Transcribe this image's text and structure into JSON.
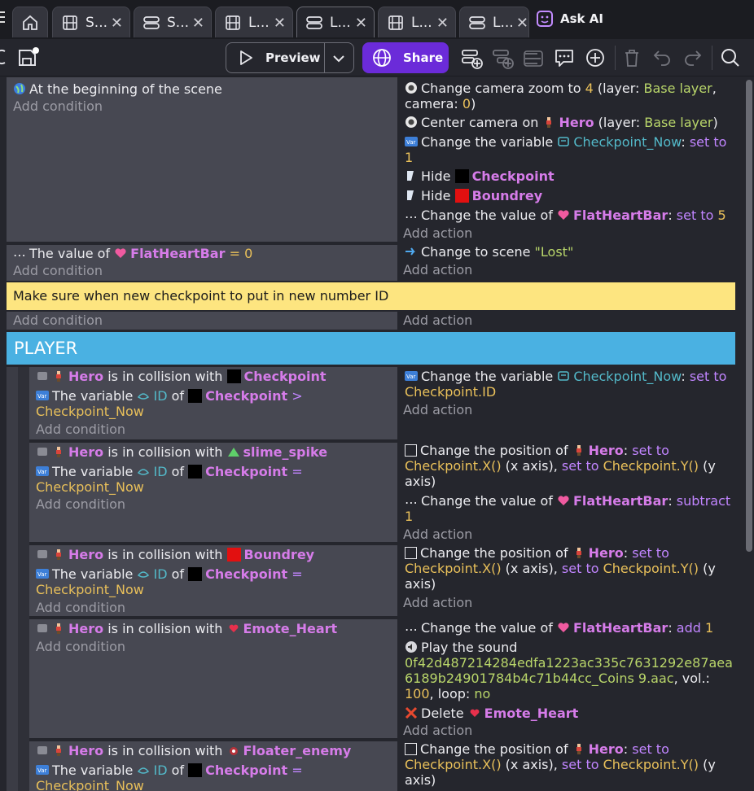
{
  "tabs": [
    {
      "label": "S...",
      "icon": "film-icon"
    },
    {
      "label": "S...",
      "icon": "layers-icon"
    },
    {
      "label": "L...",
      "icon": "film-icon"
    },
    {
      "label": "L...",
      "icon": "layers-icon"
    },
    {
      "label": "L...",
      "icon": "film-icon"
    },
    {
      "label": "L...",
      "icon": "layers-icon"
    }
  ],
  "ask_ai": "Ask AI",
  "toolbar": {
    "preview": "Preview",
    "share": "Share"
  },
  "events": {
    "e1": {
      "cond": "At the beginning of the scene",
      "add_condition": "Add condition",
      "a1": {
        "pre": "Change camera zoom to ",
        "value": "4",
        "mid": " (layer: ",
        "layer": "Base layer",
        "post": ",",
        "line2": "camera: ",
        "camera": "0",
        "close": ")"
      },
      "a2": {
        "pre": "Center camera on ",
        "obj": "Hero",
        "mid": " (layer: ",
        "layer": "Base layer",
        "post": ")"
      },
      "a3": {
        "pre": "Change the variable ",
        "var": "Checkpoint_Now",
        "op": "set to",
        "value": "1"
      },
      "a4": {
        "pre": "Hide ",
        "obj": "Checkpoint"
      },
      "a5": {
        "pre": "Hide ",
        "obj": "Boundrey"
      },
      "a6": {
        "pre": "Change the value of ",
        "obj": "FlatHeartBar",
        "op": "set to",
        "value": "5"
      },
      "add_action": "Add action"
    },
    "e2": {
      "cond_pre": "The value of ",
      "obj": "FlatHeartBar",
      "cond_op": "= ",
      "value": "0",
      "add_condition": "Add condition",
      "act_pre": "Change to scene ",
      "scene": "\"Lost\"",
      "add_action": "Add action"
    },
    "comment": "Make sure when new checkpoint to put in new number ID",
    "e3": {
      "add_condition": "Add condition",
      "add_action": "Add action"
    },
    "group": "PLAYER",
    "p1": {
      "c1_obj": "Hero",
      "c1_mid": " is in collision with ",
      "c1_target": "Checkpoint",
      "c2_pre": "The variable ",
      "c2_var": "ID",
      "c2_of": " of ",
      "c2_obj": "Checkpoint",
      "c2_op": " >",
      "c2_val": "Checkpoint_Now",
      "add_condition": "Add condition",
      "a1_pre": "Change the variable ",
      "a1_var": "Checkpoint_Now",
      "a1_op": "set to",
      "a1_val": "Checkpoint.ID",
      "add_action": "Add action"
    },
    "p2": {
      "c1_obj": "Hero",
      "c1_mid": " is in collision with ",
      "c1_target": "slime_spike",
      "c2_pre": "The variable ",
      "c2_var": "ID",
      "c2_of": " of ",
      "c2_obj": "Checkpoint",
      "c2_op": " =",
      "c2_val": "Checkpoint_Now",
      "add_condition": "Add condition",
      "a1_pre": "Change the position of ",
      "a1_obj": "Hero",
      "a1_op": "set to",
      "a1_x": "Checkpoint.X()",
      "a1_xlabel": " (x axis), ",
      "a1_op2": "set to",
      "a1_y": " Checkpoint.Y()",
      "a1_ylabel": " (y",
      "a1_axis": "axis)",
      "a2_pre": "Change the value of ",
      "a2_obj": "FlatHeartBar",
      "a2_op": "subtract",
      "a2_val": "1",
      "add_action": "Add action"
    },
    "p3": {
      "c1_obj": "Hero",
      "c1_mid": " is in collision with ",
      "c1_target": "Boundrey",
      "c2_pre": "The variable ",
      "c2_var": "ID",
      "c2_of": " of ",
      "c2_obj": "Checkpoint",
      "c2_op": " =",
      "c2_val": "Checkpoint_Now",
      "add_condition": "Add condition",
      "a1_pre": "Change the position of ",
      "a1_obj": "Hero",
      "a1_op": "set to",
      "a1_x": "Checkpoint.X()",
      "a1_xlabel": " (x axis), ",
      "a1_op2": "set to",
      "a1_y": " Checkpoint.Y()",
      "a1_ylabel": " (y",
      "a1_axis": "axis)",
      "add_action": "Add action"
    },
    "p4": {
      "c1_obj": "Hero",
      "c1_mid": " is in collision with ",
      "c1_target": "Emote_Heart",
      "add_condition": "Add condition",
      "a1_pre": "Change the value of ",
      "a1_obj": "FlatHeartBar",
      "a1_op": "add",
      "a1_val": "1",
      "a2_pre": "Play the sound",
      "a2_file1": "0f42d487214284edfa1223ac335c7631292e87aea",
      "a2_file2": "6189b24901784b4c71b44cc_Coins 9.aac",
      "a2_vol": ", vol.:",
      "a2_volval": "100",
      "a2_loop": ", loop: ",
      "a2_loopval": "no",
      "a3_pre": "Delete ",
      "a3_obj": "Emote_Heart",
      "add_action": "Add action"
    },
    "p5": {
      "c1_obj": "Hero",
      "c1_mid": " is in collision with ",
      "c1_target": "Floater_enemy",
      "c2_pre": "The variable ",
      "c2_var": "ID",
      "c2_of": " of ",
      "c2_obj": "Checkpoint",
      "c2_op": " =",
      "c2_val": "Checkpoint_Now",
      "a1_pre": "Change the position of ",
      "a1_obj": "Hero",
      "a1_op": "set to",
      "a1_x": "Checkpoint.X()",
      "a1_xlabel": " (x axis), ",
      "a1_op2": "set to",
      "a1_y": " Checkpoint.Y()",
      "a1_ylabel": " (y",
      "a1_axis": "axis)"
    }
  },
  "colors": {
    "accent": "#6b2bd9",
    "group": "#4ab1e2",
    "comment": "#fde580",
    "object": "#d67ce9",
    "keyword": "#c185ff",
    "number": "#e9c05a",
    "string": "#b9d66a",
    "variable": "#53b9c9"
  }
}
